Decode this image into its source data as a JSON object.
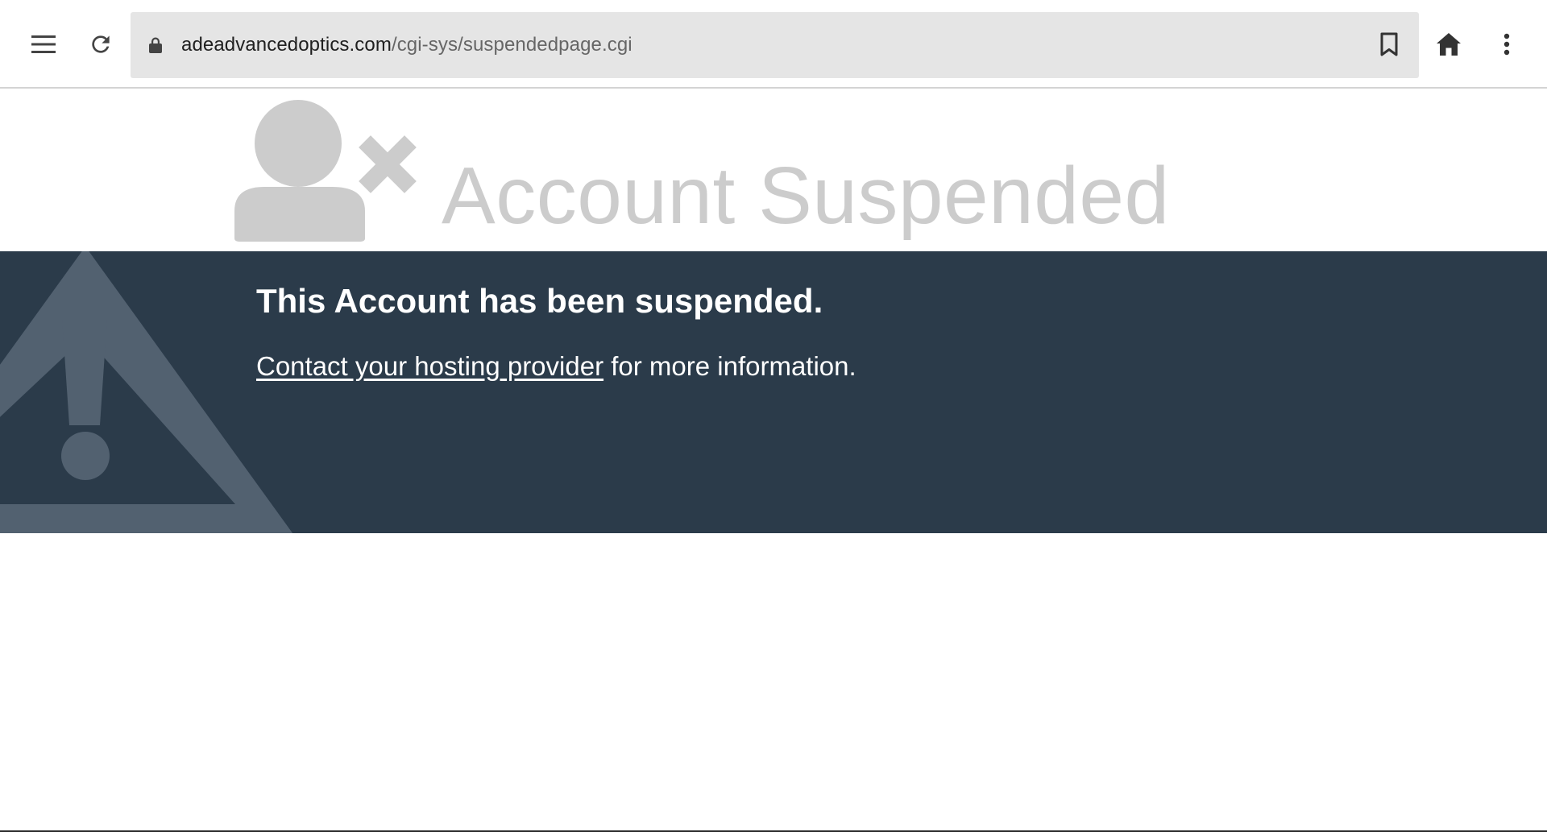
{
  "browser": {
    "url_host": "adeadvancedoptics.com",
    "url_path": "/cgi-sys/suspendedpage.cgi",
    "icons": [
      "menu-icon",
      "reload-icon",
      "lock-icon",
      "bookmark-icon",
      "home-icon",
      "more-vert-icon"
    ]
  },
  "page": {
    "title": "Account Suspended",
    "notice_title": "This Account has been suspended.",
    "contact_link": "Contact your hosting provider",
    "notice_suffix": " for more information.",
    "icons": [
      "user-suspended-icon",
      "warning-icon"
    ]
  },
  "colors": {
    "band_background": "#2b3b4a",
    "title_gray": "#cccccc",
    "omnibox_background": "#e5e5e5"
  }
}
